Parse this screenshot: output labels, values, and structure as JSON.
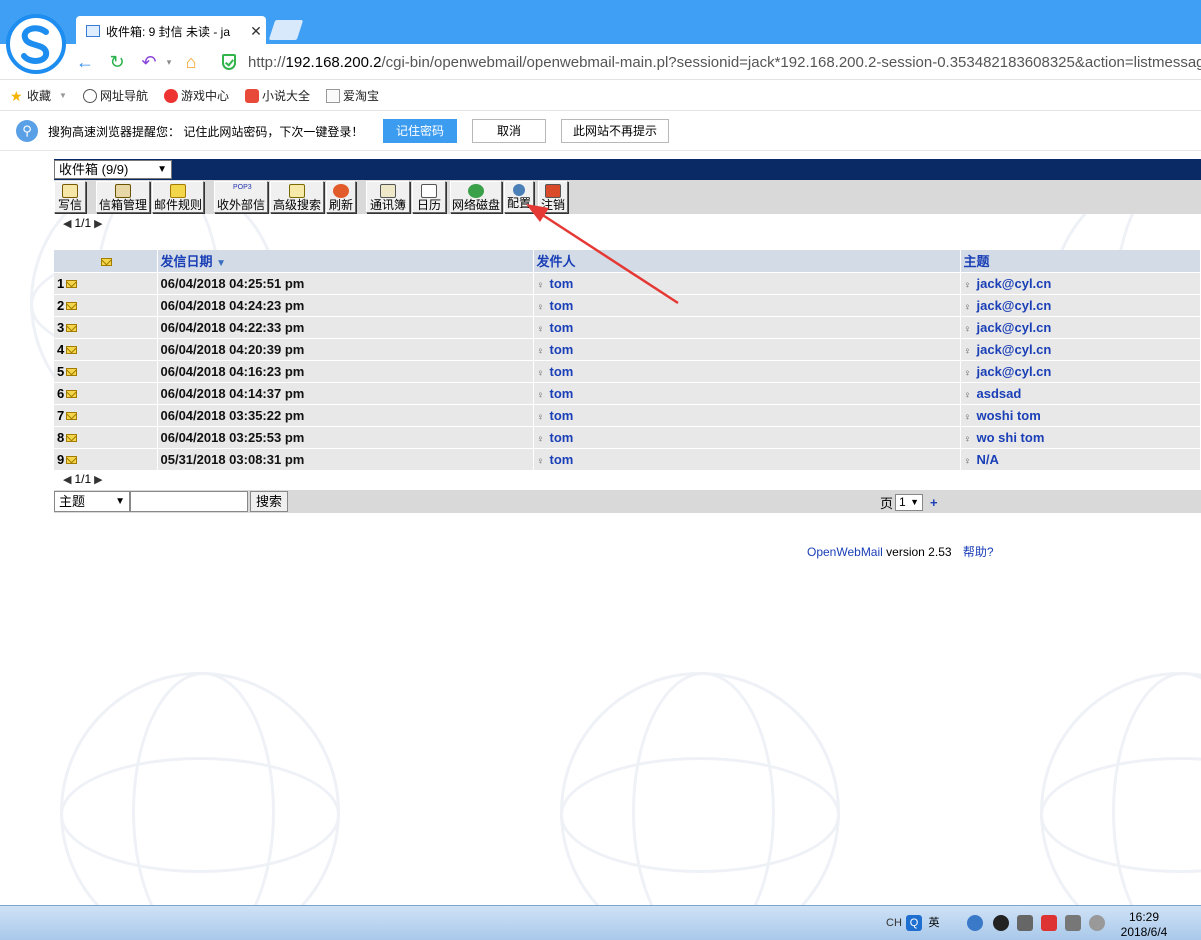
{
  "browser": {
    "tab_title": "收件箱: 9 封信 未读 - ja",
    "url_prefix": "http://",
    "url_host": "192.168.200.2",
    "url_path": "/cgi-bin/openwebmail/openwebmail-main.pl?sessionid=jack*192.168.200.2-session-0.353482183608325&action=listmessag",
    "bookmarks": [
      "收藏",
      "网址导航",
      "游戏中心",
      "小说大全",
      "爱淘宝"
    ]
  },
  "notify": {
    "message": "搜狗高速浏览器提醒您：  记住此网站密码，下次一键登录！",
    "remember_label": "记住密码",
    "cancel_label": "取消",
    "never_label": "此网站不再提示"
  },
  "mail": {
    "folder_selected": "收件箱 (9/9)",
    "toolbar": [
      "写信",
      "信箱管理",
      "邮件规则",
      "收外部信",
      "高级搜索",
      "刷新",
      "通讯簿",
      "日历",
      "网络磁盘",
      "配置",
      "注销"
    ],
    "pop3_label": "POP3",
    "pager_top": "1/1",
    "pager_bottom": "1/1",
    "columns": {
      "date": "发信日期",
      "from": "发件人",
      "subject": "主题"
    },
    "rows": [
      {
        "num": "1",
        "date": "06/04/2018 04:25:51 pm",
        "from": "tom",
        "subject": "jack@cyl.cn"
      },
      {
        "num": "2",
        "date": "06/04/2018 04:24:23 pm",
        "from": "tom",
        "subject": "jack@cyl.cn"
      },
      {
        "num": "3",
        "date": "06/04/2018 04:22:33 pm",
        "from": "tom",
        "subject": "jack@cyl.cn"
      },
      {
        "num": "4",
        "date": "06/04/2018 04:20:39 pm",
        "from": "tom",
        "subject": "jack@cyl.cn"
      },
      {
        "num": "5",
        "date": "06/04/2018 04:16:23 pm",
        "from": "tom",
        "subject": "jack@cyl.cn"
      },
      {
        "num": "6",
        "date": "06/04/2018 04:14:37 pm",
        "from": "tom",
        "subject": "asdsad"
      },
      {
        "num": "7",
        "date": "06/04/2018 03:35:22 pm",
        "from": "tom",
        "subject": "woshi tom"
      },
      {
        "num": "8",
        "date": "06/04/2018 03:25:53 pm",
        "from": "tom",
        "subject": "wo shi tom"
      },
      {
        "num": "9",
        "date": "05/31/2018 03:08:31 pm",
        "from": "tom",
        "subject": "N/A"
      }
    ],
    "search_field": "主题",
    "search_value": "",
    "search_button": "搜索",
    "page_label": "页",
    "page_value": "1",
    "page_plus": "+",
    "footer_app": "OpenWebMail",
    "footer_version": " version 2.53",
    "footer_help": "帮助?"
  },
  "taskbar": {
    "ime_code": "CH",
    "ime_lang": "英",
    "time": "16:29",
    "date": "2018/6/4"
  },
  "colors": {
    "title_bar": "#3f9ff5",
    "folder_bar": "#0a2a66",
    "link_blue": "#1a3fb6",
    "annotation_arrow": "#e53935"
  }
}
